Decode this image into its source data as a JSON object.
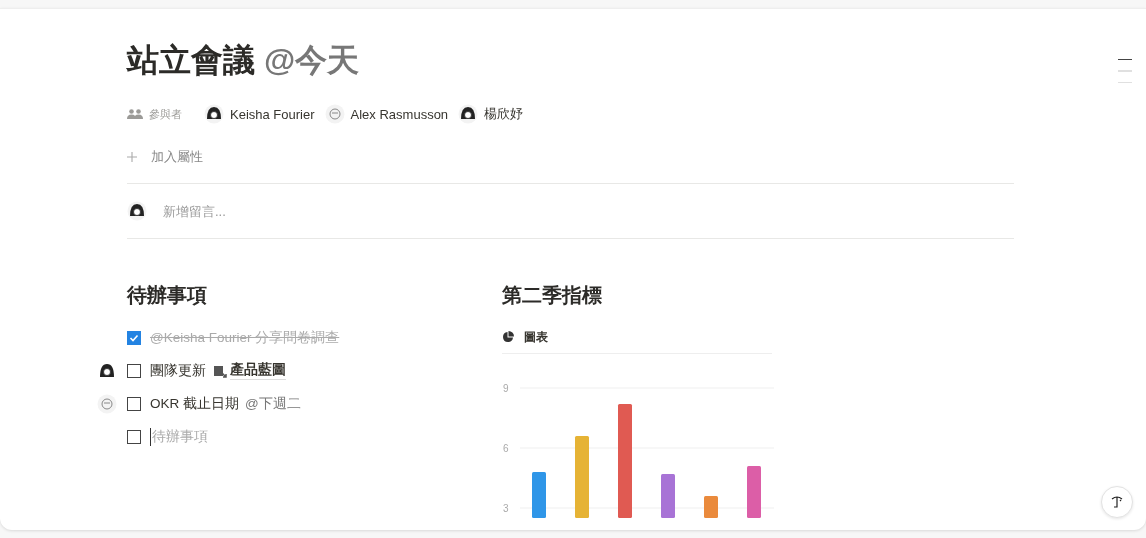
{
  "page": {
    "title": "站立會議",
    "title_mention": "@今天"
  },
  "properties": {
    "label": "參與者",
    "people": [
      {
        "name": "Keisha Fourier",
        "kind": "woman"
      },
      {
        "name": "Alex Rasmusson",
        "kind": "man"
      },
      {
        "name": "楊欣妤",
        "kind": "girl"
      }
    ],
    "add_property": "加入屬性"
  },
  "comment": {
    "placeholder": "新增留言..."
  },
  "todo": {
    "heading": "待辦事項",
    "items": [
      {
        "checked": true,
        "kind": "plain",
        "text": "@Keisha Fourier 分享問卷調查"
      },
      {
        "checked": false,
        "kind": "girl",
        "text": "團隊更新",
        "link": "產品藍圖"
      },
      {
        "checked": false,
        "kind": "man",
        "text": "OKR 截止日期",
        "mention": "@下週二"
      },
      {
        "checked": false,
        "kind": "plain",
        "placeholder": "待辦事項"
      }
    ]
  },
  "metrics": {
    "heading": "第二季指標",
    "chart_label": "圖表",
    "chart_data": {
      "type": "bar",
      "ylim": [
        3,
        9
      ],
      "yticks": [
        3,
        6,
        9
      ],
      "values": [
        4.8,
        6.6,
        8.2,
        4.7,
        3.6,
        5.1
      ],
      "colors": [
        "#2f96e8",
        "#e6b335",
        "#e05a52",
        "#a873d6",
        "#ea8a3c",
        "#dc5ea7"
      ]
    }
  }
}
